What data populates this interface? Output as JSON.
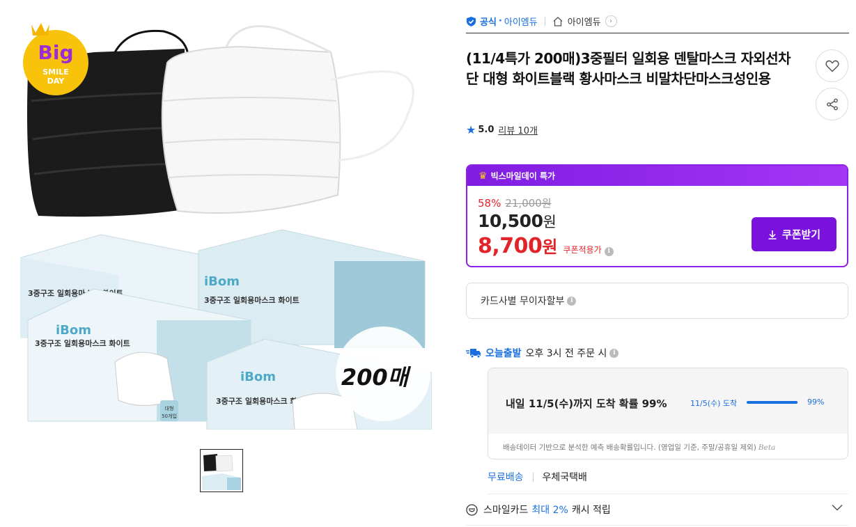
{
  "hero": {
    "badge_big": "Big",
    "badge_smile": "SMILE",
    "badge_day": "DAY",
    "count_overlay": "200매",
    "box_brand": "iBom",
    "box_title": "3중구조 일회용마스크 화이트",
    "box_count": "50개입",
    "box_tag": "대형"
  },
  "seller": {
    "official_label": "공식",
    "official_dot": "·",
    "official_store": "아이엠듀",
    "shop_name": "아이엠듀"
  },
  "product": {
    "title": "(11/4특가 200매)3중필터 일회용 덴탈마스크 자외선차단 대형 화이트블랙 황사마스크 비말차단마스크성인용",
    "rating": "5.0",
    "review_link": "리뷰 10개"
  },
  "deal": {
    "header": "빅스마일데이 특가",
    "discount_rate": "58%",
    "original_price": "21,000원",
    "sale_price": "10,500",
    "sale_currency": "원",
    "coupon_price": "8,700",
    "coupon_currency": "원",
    "coupon_label": "쿠폰적용가",
    "coupon_button": "쿠폰받기"
  },
  "installment": {
    "label": "카드사별 무이자할부"
  },
  "shipping": {
    "today_label": "오늘출발",
    "cutoff": "오후 3시 전 주문 시",
    "arrive_text": "내일 11/5(수)까지 도착 확률 99%",
    "prob_label": "11/5(수) 도착",
    "prob_pct": "99%",
    "prob_value": 0.99,
    "note": "배송데이터 기반으로 분석한 예측 배송확률입니다. (영업일 기준, 주말/공휴일 제외)",
    "beta": "Beta",
    "free_label": "무료배송",
    "carrier": "우체국택배"
  },
  "smilecard": {
    "prefix": "스마일카드",
    "max": "최대 2%",
    "suffix": "캐시 적립"
  },
  "colors": {
    "accent_blue": "#1a6fe0",
    "deal_purple": "#7a12de",
    "price_red": "#e3232a"
  }
}
